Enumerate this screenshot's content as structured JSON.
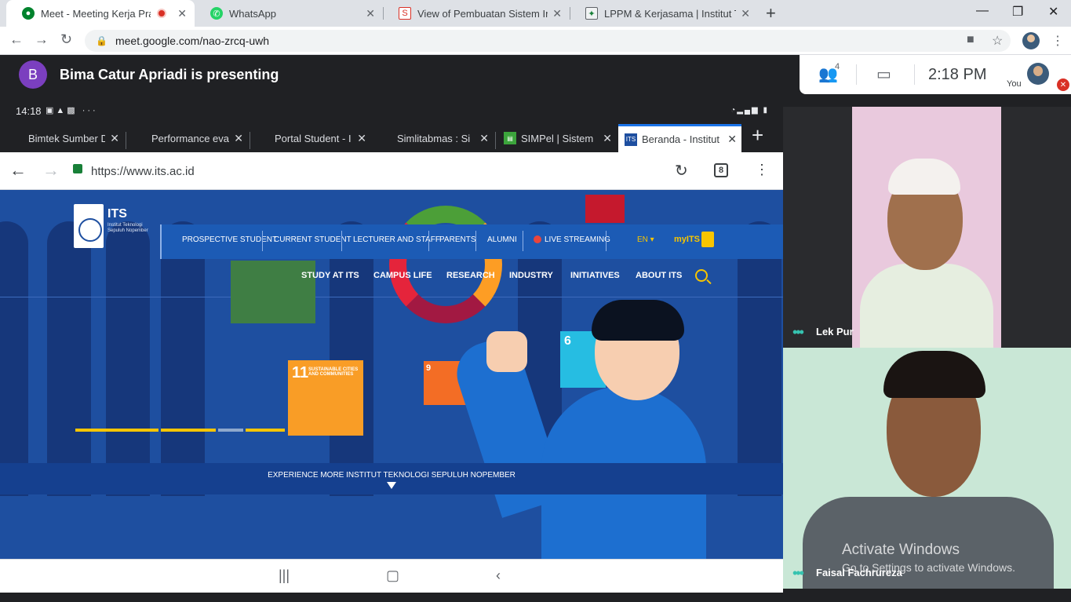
{
  "browser": {
    "tabs": [
      {
        "title": "Meet - Meeting Kerja Praktek",
        "favicon": "meet-icon",
        "recording": true
      },
      {
        "title": "WhatsApp",
        "favicon": "whatsapp-icon"
      },
      {
        "title": "View of Pembuatan Sistem Informasi",
        "favicon": "document-icon"
      },
      {
        "title": "LPPM & Kerjasama | Institut Teknologi",
        "favicon": "lppm-icon"
      }
    ],
    "address": "meet.google.com/nao-zrcq-uwh"
  },
  "meet": {
    "presenter_initial": "B",
    "presenting_text": "Bima Catur Apriadi is presenting",
    "people_count": "4",
    "time": "2:18 PM",
    "self_label": "You",
    "participants": [
      {
        "name": "Lek Pur"
      },
      {
        "name": "Faisal Fachrureza"
      }
    ],
    "watermark_title": "Activate Windows",
    "watermark_sub": "Go to Settings to activate Windows."
  },
  "shared_screen": {
    "status_time": "14:18",
    "tabs": [
      {
        "title": "Bimtek Sumber D"
      },
      {
        "title": "Performance eva"
      },
      {
        "title": "Portal Student - I"
      },
      {
        "title": "Simlitabmas : Si"
      },
      {
        "title": "SIMPel | Sistem"
      },
      {
        "title": "Beranda - Institut",
        "active": true
      }
    ],
    "url": "https://www.its.ac.id",
    "tab_count": "8",
    "site": {
      "logo_name": "ITS",
      "logo_sub": "Institut Teknologi Sepuluh Nopember",
      "top_nav": [
        "PROSPECTIVE STUDENT",
        "CURRENT STUDENT",
        "LECTURER AND STAFF",
        "PARENTS",
        "ALUMNI",
        "LIVE STREAMING"
      ],
      "lang": "EN ▾",
      "myits": "myITS",
      "main_nav": [
        "STUDY AT ITS",
        "CAMPUS LIFE",
        "RESEARCH",
        "INDUSTRY",
        "INITIATIVES",
        "ABOUT ITS"
      ],
      "sdg11_num": "11",
      "sdg11_text": "SUSTAINABLE CITIES AND COMMUNITIES",
      "sdg9_num": "9",
      "sdg6_num": "6",
      "experience": "EXPERIENCE MORE INSTITUT TEKNOLOGI SEPULUH NOPEMBER"
    }
  },
  "colors": {
    "meet_bg": "#202124",
    "its_blue": "#1e4fa0",
    "its_yellow": "#f7c500",
    "presenter_avatar": "#7b3fbf"
  }
}
